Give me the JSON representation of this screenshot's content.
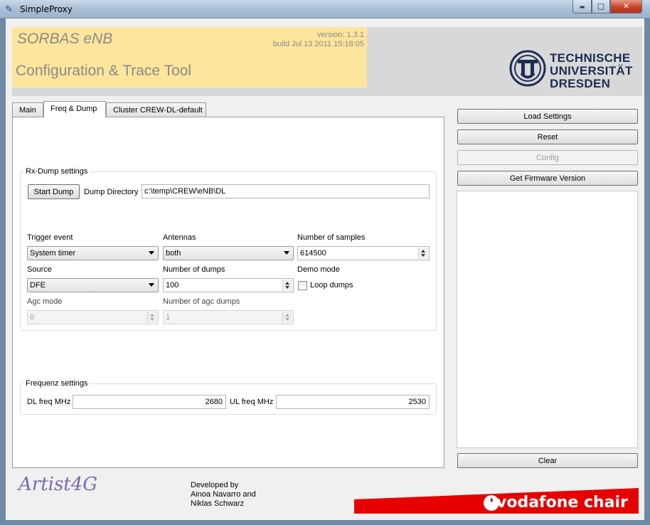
{
  "window": {
    "title": "SimpleProxy",
    "minimize_glyph": "▬",
    "maximize_glyph": "▢",
    "close_glyph": "✕",
    "app_icon": "feather-icon"
  },
  "header": {
    "app_name": "SORBAS eNB",
    "subtitle": "Configuration & Trace Tool",
    "version": "version: 1.3.1",
    "build": "build Jul 13 2011 15:18:05",
    "university_lines": [
      "TECHNISCHE",
      "UNIVERSITÄT",
      "DRESDEN"
    ]
  },
  "tabs": [
    {
      "label": "Main",
      "active": false
    },
    {
      "label": "Freq & Dump",
      "active": true
    },
    {
      "label": "Cluster CREW-DL-default",
      "active": false
    }
  ],
  "rx_dump": {
    "group_title": "Rx-Dump settings",
    "start_button": "Start Dump",
    "dir_label": "Dump Directory",
    "dir_value": "c:\\temp\\CREW\\eNB\\DL",
    "trigger_label": "Trigger event",
    "trigger_value": "System timer",
    "antennas_label": "Antennas",
    "antennas_value": "both",
    "samples_label": "Number of samples",
    "samples_value": "614500",
    "source_label": "Source",
    "source_value": "DFE",
    "dumps_label": "Number of dumps",
    "dumps_value": "100",
    "demo_label": "Demo mode",
    "loop_label": "Loop dumps",
    "loop_checked": false,
    "agc_label": "Agc mode",
    "agc_value": "0",
    "agc_dumps_label": "Number of agc dumps",
    "agc_dumps_value": "1"
  },
  "freq": {
    "group_title": "Frequenz settings",
    "dl_label": "DL freq MHz",
    "dl_value": "2680",
    "ul_label": "UL freq MHz",
    "ul_value": "2530"
  },
  "side": {
    "load": "Load Settings",
    "reset": "Reset",
    "config": "Config",
    "firmware": "Get Firmware Version",
    "clear": "Clear"
  },
  "footer": {
    "artist_logo": "Artist4G",
    "developed_by": [
      "Developed by",
      "Ainoa Navarro and",
      "Niklas Schwarz"
    ],
    "vodafone": "vodafone chair",
    "vodafone_icon": "speechmark-icon"
  },
  "colors": {
    "header_yellow": "#fde59b",
    "vodafone_red": "#e60000",
    "tud_blue": "#1b2d54"
  }
}
